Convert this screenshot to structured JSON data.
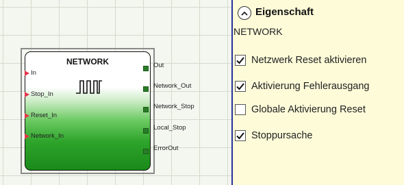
{
  "block": {
    "title": "NETWORK",
    "inputs": [
      {
        "label": "In"
      },
      {
        "label": "Stop_In"
      },
      {
        "label": "Reset_In"
      },
      {
        "label": "Network_In"
      }
    ],
    "outputs": [
      {
        "label": "Out"
      },
      {
        "label": "Network_Out"
      },
      {
        "label": "Network_Stop"
      },
      {
        "label": "Local_Stop"
      },
      {
        "label": "ErrorOut"
      }
    ],
    "icon": "pulse-wave-icon"
  },
  "properties": {
    "heading": "Eigenschaft",
    "collapse_icon": "chevron-up-icon",
    "subtitle": "NETWORK",
    "options": [
      {
        "label": "Netzwerk Reset aktivieren",
        "checked": true
      },
      {
        "label": "Aktivierung Fehlerausgang",
        "checked": true
      },
      {
        "label": "Globale Aktivierung Reset",
        "checked": false
      },
      {
        "label": "Stoppursache",
        "checked": true
      }
    ]
  },
  "colors": {
    "panel_bg": "#fdfbd8",
    "divider": "#27339a",
    "input_arrow": "#e3364a",
    "block_green": "#2ea42b"
  }
}
